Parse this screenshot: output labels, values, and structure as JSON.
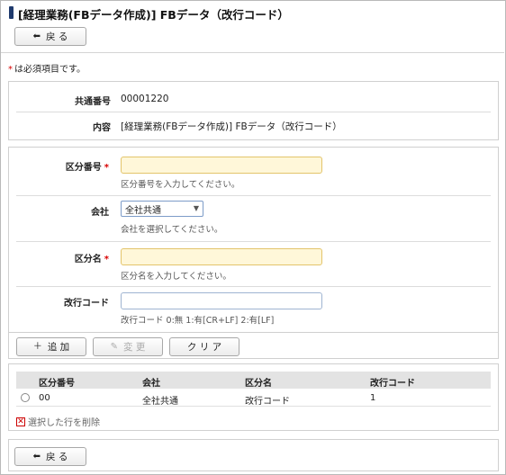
{
  "header": {
    "title": "[経理業務(FBデータ作成)] FBデータ（改行コード）",
    "back_label": "戻 る"
  },
  "required_note": "は必須項目です。",
  "required_mark": "*",
  "info": {
    "common_no_label": "共通番号",
    "common_no_value": "00001220",
    "content_label": "内容",
    "content_value": "[経理業務(FBデータ作成)] FBデータ（改行コード）"
  },
  "form": {
    "category_no": {
      "label": "区分番号",
      "value": "",
      "hint": "区分番号を入力してください。"
    },
    "company": {
      "label": "会社",
      "selected": "全社共通",
      "hint": "会社を選択してください。"
    },
    "category_name": {
      "label": "区分名",
      "value": "",
      "hint": "区分名を入力してください。"
    },
    "newline_code": {
      "label": "改行コード",
      "value": "",
      "hint": "改行コード 0:無 1:有[CR+LF] 2:有[LF]"
    }
  },
  "actions": {
    "add_label": "追 加",
    "change_label": "変 更",
    "clear_label": "ク リ ア"
  },
  "table": {
    "columns": [
      "区分番号",
      "会社",
      "区分名",
      "改行コード"
    ],
    "rows": [
      {
        "cells": [
          "00",
          "全社共通",
          "改行コード",
          "1"
        ]
      }
    ],
    "delete_label": "選択した行を削除"
  },
  "footer": {
    "back_label": "戻 る"
  },
  "colors": {
    "required": "#d80000",
    "title_bar": "#1f3a6d",
    "required_field_bg": "#fff7d9"
  },
  "icons": {
    "back": "arrow-left-icon",
    "add": "plus-icon",
    "change": "pencil-icon",
    "delete": "delete-x-icon"
  }
}
